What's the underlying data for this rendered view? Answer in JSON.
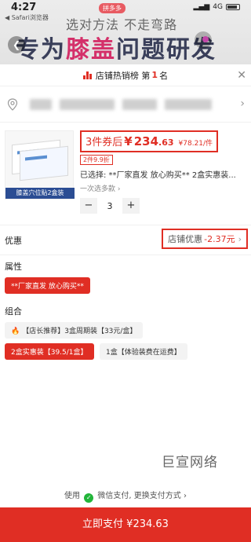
{
  "status": {
    "time": "4:27",
    "carrier": "◀ Safari浏览器",
    "network": "4G"
  },
  "banner": {
    "badge": "拼多多",
    "slogan_top": "选对方法 不走弯路",
    "slogan_pre": "专为",
    "slogan_highlight": "膝盖",
    "slogan_post": "问题研发"
  },
  "rank": {
    "prefix": "店铺热销榜 第",
    "number": "1",
    "suffix": "名"
  },
  "product": {
    "image_tag": "膝盖穴位贴2盒装",
    "price_prefix": "3件券后",
    "price_currency": "¥",
    "price_int": "234",
    "price_dec": ".63",
    "unit_price": "¥78.21/件",
    "discount_tag": "2件9.9折",
    "selected": "已选择: **厂家直发 放心购买** 2盒实惠装...",
    "multi_select": "一次选多款",
    "quantity": "3",
    "minus": "−",
    "plus": "+"
  },
  "discount": {
    "label": "优惠",
    "shop_label": "店铺优惠",
    "value": "-2.37元"
  },
  "attribute": {
    "label": "属性",
    "option": "**厂家直发 放心购买**"
  },
  "combo": {
    "label": "组合",
    "options": [
      "【店长推荐】3盒周期装【33元/盒】",
      "2盒实惠装【39.5/1盒】",
      "1盒【体验装费在运费】"
    ]
  },
  "watermark": "巨宣网络",
  "payment": {
    "prefix": "使用",
    "method": "微信支付,",
    "change": "更换支付方式",
    "button": "立即支付 ¥234.63"
  },
  "colors": {
    "accent": "#e02e24",
    "wechat": "#22b53a"
  }
}
